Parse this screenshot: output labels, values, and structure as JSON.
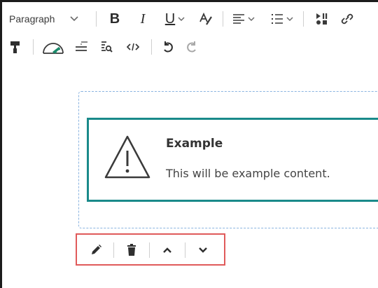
{
  "toolbar": {
    "paragraph_select": {
      "value": "Paragraph"
    },
    "bold_label": "B",
    "italic_label": "I",
    "underline_label": "U"
  },
  "callout": {
    "title": "Example",
    "text": "This will be example content."
  },
  "colors": {
    "callout_border": "#1a8a8a",
    "block_outline": "#8ab4e0",
    "highlight": "#e05a5a",
    "speed_gauge": "#1a8a6a"
  },
  "icons": {
    "row1": [
      "chevron-down-icon",
      "text-color-icon",
      "align-icon",
      "list-icon",
      "insert-stuff-icon",
      "link-icon"
    ],
    "row2": [
      "format-painter-icon",
      "accessibility-checker-icon",
      "word-count-icon",
      "find-replace-icon",
      "source-code-icon",
      "undo-icon",
      "redo-icon"
    ],
    "block_actions": [
      "pencil-icon",
      "trash-icon",
      "chevron-up-icon",
      "chevron-down-icon"
    ]
  }
}
